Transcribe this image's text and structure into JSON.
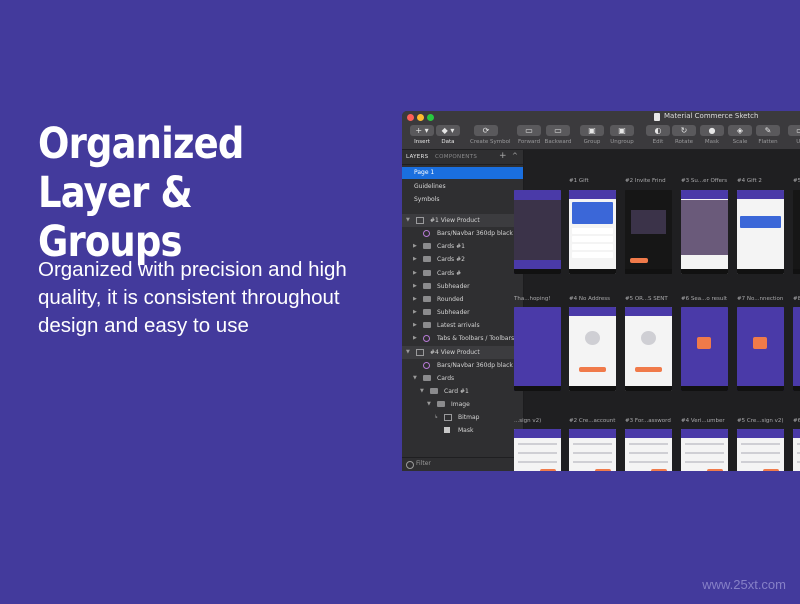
{
  "headline": "Organized Layer & Groups",
  "body": "Organized with precision and high quality, it is consistent throughout design and easy to use",
  "watermark": "www.25xt.com",
  "window": {
    "title": "Material Commerce Sketch",
    "traffic_lights": {
      "close": "#fe5f57",
      "minimize": "#febc2e",
      "zoom": "#28c840"
    }
  },
  "toolbar": {
    "items": [
      {
        "label": "Insert",
        "glyph": "+ ▾"
      },
      {
        "label": "Data",
        "glyph": "◆ ▾"
      },
      {
        "label": "Create Symbol",
        "glyph": "⟳"
      },
      {
        "label": "Forward",
        "glyph": "▭"
      },
      {
        "label": "Backward",
        "glyph": "▭"
      },
      {
        "label": "Group",
        "glyph": "▣"
      },
      {
        "label": "Ungroup",
        "glyph": "▣"
      },
      {
        "label": "Edit",
        "glyph": "◐"
      },
      {
        "label": "Rotate",
        "glyph": "↻"
      },
      {
        "label": "Mask",
        "glyph": "●"
      },
      {
        "label": "Scale",
        "glyph": "◈"
      },
      {
        "label": "Flatten",
        "glyph": "✎"
      },
      {
        "label": "Un",
        "glyph": "▭"
      }
    ]
  },
  "sidebar": {
    "tab_layers": "LAYERS",
    "tab_components": "COMPONENTS",
    "add": "+",
    "collapse": "^",
    "pages": [
      {
        "label": "Page 1",
        "selected": true
      },
      {
        "label": "Guidelines",
        "selected": false
      },
      {
        "label": "Symbols",
        "selected": false
      }
    ],
    "layers": [
      {
        "label": "#1 View Product",
        "indent": 0,
        "kind": "artboard",
        "arrow": "▼"
      },
      {
        "label": "Bars/Navbar 360dp black",
        "indent": 1,
        "kind": "symbol",
        "arrow": ""
      },
      {
        "label": "Cards #1",
        "indent": 1,
        "kind": "folder",
        "arrow": "▶"
      },
      {
        "label": "Cards #2",
        "indent": 1,
        "kind": "folder",
        "arrow": "▶"
      },
      {
        "label": "Cards #",
        "indent": 1,
        "kind": "folder",
        "arrow": "▶"
      },
      {
        "label": "Subheader",
        "indent": 1,
        "kind": "folder",
        "arrow": "▶"
      },
      {
        "label": "Rounded",
        "indent": 1,
        "kind": "folder",
        "arrow": "▶"
      },
      {
        "label": "Subheader",
        "indent": 1,
        "kind": "folder",
        "arrow": "▶"
      },
      {
        "label": "Latest arrivals",
        "indent": 1,
        "kind": "folder",
        "arrow": "▶"
      },
      {
        "label": "Tabs & Toolbars / Toolbars /...",
        "indent": 1,
        "kind": "symbol",
        "arrow": "▶"
      },
      {
        "label": "#4 View Product",
        "indent": 0,
        "kind": "artboard",
        "arrow": "▼"
      },
      {
        "label": "Bars/Navbar 360dp black",
        "indent": 1,
        "kind": "symbol",
        "arrow": ""
      },
      {
        "label": "Cards",
        "indent": 1,
        "kind": "folder",
        "arrow": "▼"
      },
      {
        "label": "Card #1",
        "indent": 2,
        "kind": "folder",
        "arrow": "▼"
      },
      {
        "label": "Image",
        "indent": 3,
        "kind": "folder",
        "arrow": "▼"
      },
      {
        "label": "Bitmap",
        "indent": 4,
        "kind": "image",
        "arrow": "↳"
      },
      {
        "label": "Mask",
        "indent": 4,
        "kind": "mask",
        "arrow": ""
      }
    ],
    "filter": "Filter"
  },
  "canvas": {
    "rows": [
      [
        "",
        "#1 Gift",
        "#2 Invite Frind",
        "#3 Su...er Offers",
        "#4 Gift 2",
        "#5"
      ],
      [
        "Tha...hoping!",
        "#4 No Address",
        "#5 OR...S SENT",
        "#6 Sea...o result",
        "#7 No...nnection",
        "#8"
      ],
      [
        "...sign v2)",
        "#2 Cre...account",
        "#3 For...assword",
        "#4 Veri...umber",
        "#5 Cre...sign v2)",
        "#6"
      ]
    ]
  }
}
